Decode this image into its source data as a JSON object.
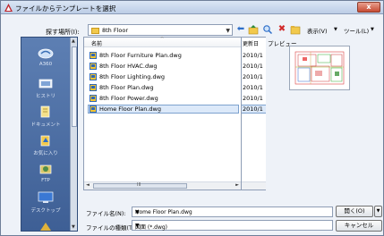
{
  "window": {
    "title": "ファイルからテンプレートを選択",
    "close_label": "x"
  },
  "lookin": {
    "label": "探す場所(I):",
    "value": "8th Floor"
  },
  "toolbar": {
    "view_menu": "表示(V)",
    "tools_menu": "ツール(L)"
  },
  "places": [
    {
      "label": "A360",
      "icon": "cloud-icon"
    },
    {
      "label": "ヒストリ",
      "icon": "history-icon"
    },
    {
      "label": "ドキュメント",
      "icon": "documents-icon"
    },
    {
      "label": "お気に入り",
      "icon": "favorites-icon"
    },
    {
      "label": "FTP",
      "icon": "ftp-icon"
    },
    {
      "label": "デスクトップ",
      "icon": "desktop-icon"
    }
  ],
  "filelist": {
    "col_name": "名前",
    "col_date": "更新日",
    "files": [
      {
        "name": "8th Floor Furniture Plan.dwg",
        "date": "2010/1"
      },
      {
        "name": "8th Floor HVAC.dwg",
        "date": "2010/1"
      },
      {
        "name": "8th Floor Lighting.dwg",
        "date": "2010/1"
      },
      {
        "name": "8th Floor Plan.dwg",
        "date": "2010/1"
      },
      {
        "name": "8th Floor Power.dwg",
        "date": "2010/1"
      },
      {
        "name": "Home Floor Plan.dwg",
        "date": "2010/1",
        "selected": true
      }
    ],
    "hscroll_grip": "III"
  },
  "preview": {
    "label": "プレビュー"
  },
  "bottom": {
    "filename_label": "ファイル名(N):",
    "filename_value": "Home Floor Plan.dwg",
    "filetype_label": "ファイルの種類(T):",
    "filetype_value": "図面 (*.dwg)",
    "open_label": "開く(O)",
    "cancel_label": "キャンセル"
  }
}
